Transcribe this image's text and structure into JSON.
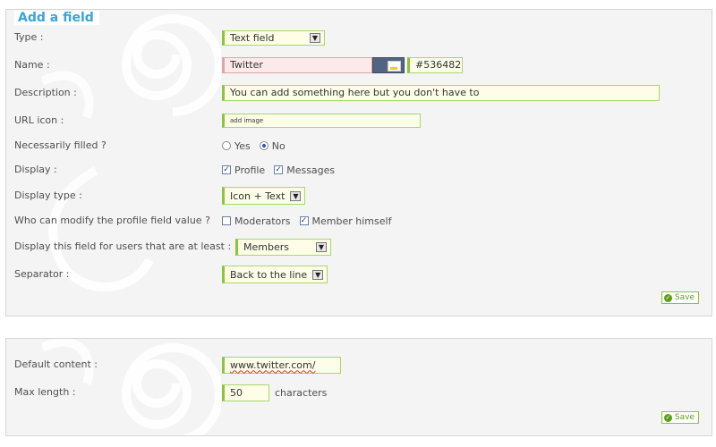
{
  "section1": {
    "legend": "Add a field",
    "fields": {
      "type": {
        "label": "Type :",
        "value": "Text field"
      },
      "name": {
        "label": "Name :",
        "value": "Twitter",
        "color_value": "#536482"
      },
      "description": {
        "label": "Description :",
        "value": "You can add something here but you don't have to"
      },
      "url_icon": {
        "label": "URL icon :",
        "value": "add image"
      },
      "necessarily": {
        "label": "Necessarily filled ?",
        "yes": "Yes",
        "no": "No",
        "selected": "No"
      },
      "display": {
        "label": "Display :",
        "profile": "Profile",
        "messages": "Messages",
        "profile_checked": true,
        "messages_checked": true
      },
      "display_type": {
        "label": "Display type :",
        "value": "Icon + Text"
      },
      "who_modify": {
        "label": "Who can modify the profile field value ?",
        "moderators": "Moderators",
        "member_himself": "Member himself",
        "moderators_checked": false,
        "member_checked": true
      },
      "display_for": {
        "label": "Display this field for users that are at least :",
        "value": "Members"
      },
      "separator": {
        "label": "Separator :",
        "value": "Back to the line"
      }
    },
    "save_label": "Save"
  },
  "section2": {
    "fields": {
      "default_content": {
        "label": "Default content :",
        "value": "www.twitter.com/"
      },
      "max_length": {
        "label": "Max length :",
        "value": "50",
        "unit": "characters"
      }
    },
    "save_label": "Save"
  },
  "colors": {
    "accent_green": "#8cc43c",
    "title_blue": "#3aa3d7",
    "required_red": "#c62828",
    "swatch": "#536482"
  }
}
